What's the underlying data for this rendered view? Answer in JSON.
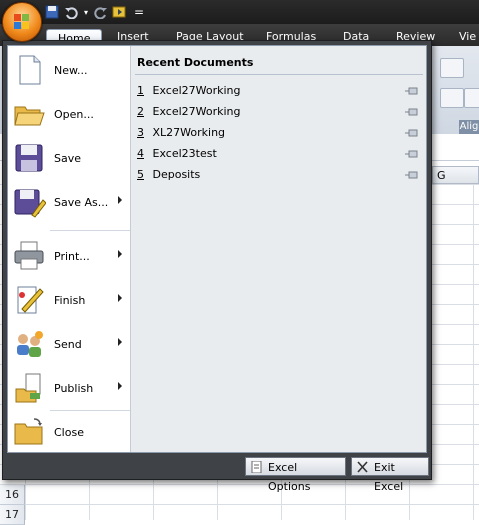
{
  "ribbon": {
    "tabs": [
      {
        "label": "Home"
      },
      {
        "label": "Insert"
      },
      {
        "label": "Page Layout"
      },
      {
        "label": "Formulas"
      },
      {
        "label": "Data"
      },
      {
        "label": "Review"
      },
      {
        "label": "Vie"
      }
    ],
    "group_label_partial": "Alig",
    "qat_overflow": "="
  },
  "grid": {
    "visible_column": "G",
    "visible_rows": [
      "16",
      "17"
    ]
  },
  "office_menu": {
    "items": [
      {
        "label": "New...",
        "icon": "new-document-icon",
        "has_submenu": false
      },
      {
        "label": "Open...",
        "icon": "open-folder-icon",
        "has_submenu": false
      },
      {
        "label": "Save",
        "icon": "save-disk-icon",
        "has_submenu": false
      },
      {
        "label": "Save As...",
        "icon": "save-as-icon",
        "has_submenu": true
      },
      {
        "label": "Print...",
        "icon": "printer-icon",
        "has_submenu": true
      },
      {
        "label": "Finish",
        "icon": "finish-pencil-icon",
        "has_submenu": true
      },
      {
        "label": "Send",
        "icon": "send-people-icon",
        "has_submenu": true
      },
      {
        "label": "Publish",
        "icon": "publish-icon",
        "has_submenu": true
      },
      {
        "label": "Close",
        "icon": "close-folder-icon",
        "has_submenu": false
      }
    ],
    "recent": {
      "title": "Recent Documents",
      "documents": [
        {
          "num": "1",
          "name": "Excel27Working"
        },
        {
          "num": "2",
          "name": "Excel27Working"
        },
        {
          "num": "3",
          "name": "XL27Working"
        },
        {
          "num": "4",
          "name": "Excel23test"
        },
        {
          "num": "5",
          "name": "Deposits"
        }
      ]
    },
    "buttons": {
      "options": "Excel Options",
      "exit": "Exit Excel"
    }
  }
}
